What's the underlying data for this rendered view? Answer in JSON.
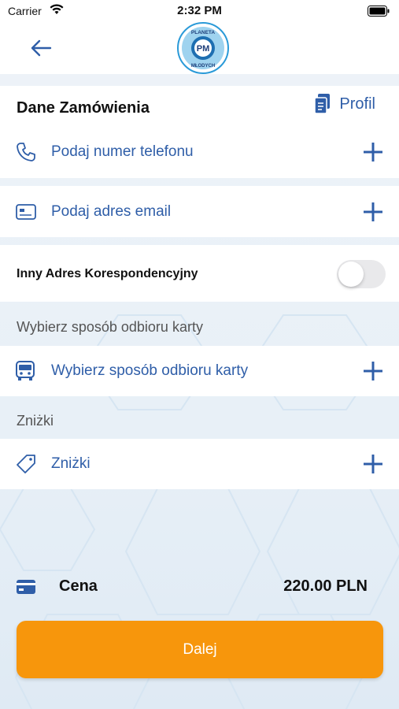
{
  "status_bar": {
    "carrier": "Carrier",
    "time": "2:32 PM"
  },
  "logo": {
    "top_text": "PLANETA",
    "bottom_text": "MŁODYCH",
    "monogram": "PM"
  },
  "order": {
    "title": "Dane Zamówienia",
    "profile_label": "Profil",
    "phone_label": "Podaj numer telefonu",
    "email_label": "Podaj adres email",
    "alt_address_label": "Inny Adres Korespondencyjny",
    "alt_address_enabled": false
  },
  "card_pickup": {
    "section_title": "Wybierz sposób odbioru karty",
    "row_label": "Wybierz sposób odbioru karty"
  },
  "discounts": {
    "section_title": "Zniżki",
    "row_label": "Zniżki"
  },
  "price": {
    "label": "Cena",
    "value": "220.00 PLN"
  },
  "next_button": {
    "label": "Dalej"
  },
  "colors": {
    "accent": "#2f5ea8",
    "button": "#f7960c"
  }
}
